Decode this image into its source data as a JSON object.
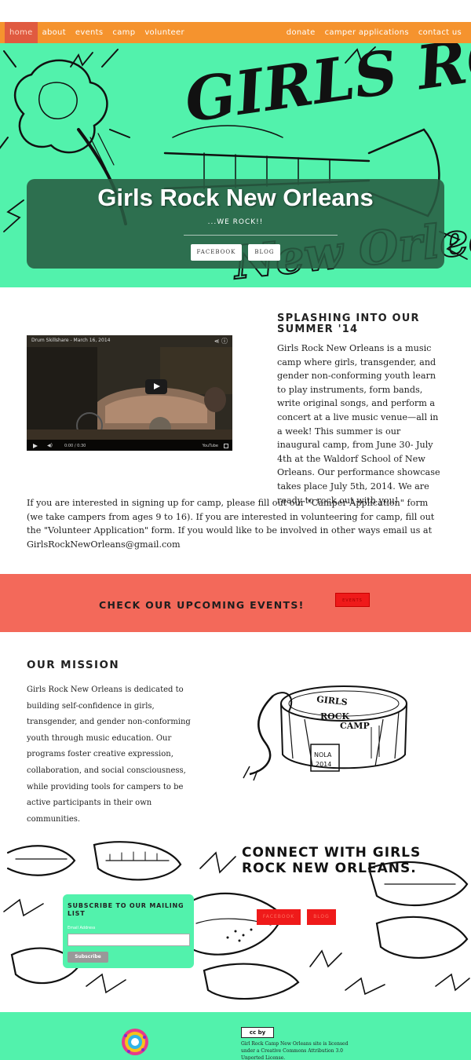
{
  "nav": {
    "left": [
      "home",
      "about",
      "events",
      "camp",
      "volunteer"
    ],
    "right": [
      "donate",
      "camper applications",
      "contact us"
    ],
    "active": "home"
  },
  "hero": {
    "art_text_top": "GIRLS ROCK",
    "art_text_bottom": "New Orleans",
    "title": "Girls Rock New Orleans",
    "tagline": "...WE ROCK!!",
    "buttons": [
      "FACEBOOK",
      "BLOG"
    ]
  },
  "video": {
    "title": "Drum Skillshare - March 16, 2014",
    "time": "0:00 / 0:30",
    "brand": "YouTube",
    "share_icon": "share-icon",
    "info_icon": "info-icon"
  },
  "intro": {
    "heading": "Splashing Into Our Summer '14",
    "paragraph": "Girls Rock New Orleans is a music camp where girls, transgender, and gender non-conforming youth learn to play instruments, form bands, write original songs, and perform a concert at a live music venue—all in a week! This summer is our inaugural camp, from June 30- July 4th at the Waldorf School of New Orleans. Our performance showcase takes place July 5th, 2014. We are ready to rock out with you!",
    "paragraph2": "If you are interested in signing up for camp, please fill out our \"Camper Application\" form (we take campers from ages 9 to 16). If you are interested in volunteering for camp, fill out the \"Volunteer Application\" form. If you would like to be involved in other ways email us at GirlsRockNewOrleans@gmail.com"
  },
  "events": {
    "heading": "CHECK OUR UPCOMING EVENTS!",
    "button": "EVENTS"
  },
  "mission": {
    "heading": "OUR MISSION",
    "paragraph": "Girls Rock New Orleans is dedicated to building self-confidence in girls, transgender, and gender non-conforming youth through music education. Our programs foster creative expression, collaboration, and social consciousness, while providing tools for campers to be active participants in their own communities.",
    "drum_text": [
      "GIRLS",
      "ROCK",
      "CAMP"
    ],
    "drum_label": [
      "NOLA",
      "2014"
    ]
  },
  "connect": {
    "heading": "Connect with Girls Rock New Orleans.",
    "buttons": [
      "FACEBOOK",
      "BLOG"
    ]
  },
  "signup": {
    "heading": "Subscribe to our mailing list",
    "email_label": "Email Address",
    "email_value": "",
    "button": "Subscribe"
  },
  "footer": {
    "cc_badge": "cc by",
    "license": "Girl Rock Camp New Orleans site is licensed under a Creative Commons Attribution 3.0 Unported License."
  },
  "colors": {
    "mint": "#52f2ac",
    "orange": "#f5932e",
    "coral": "#f3695a",
    "red_button": "#ef1a1a"
  }
}
